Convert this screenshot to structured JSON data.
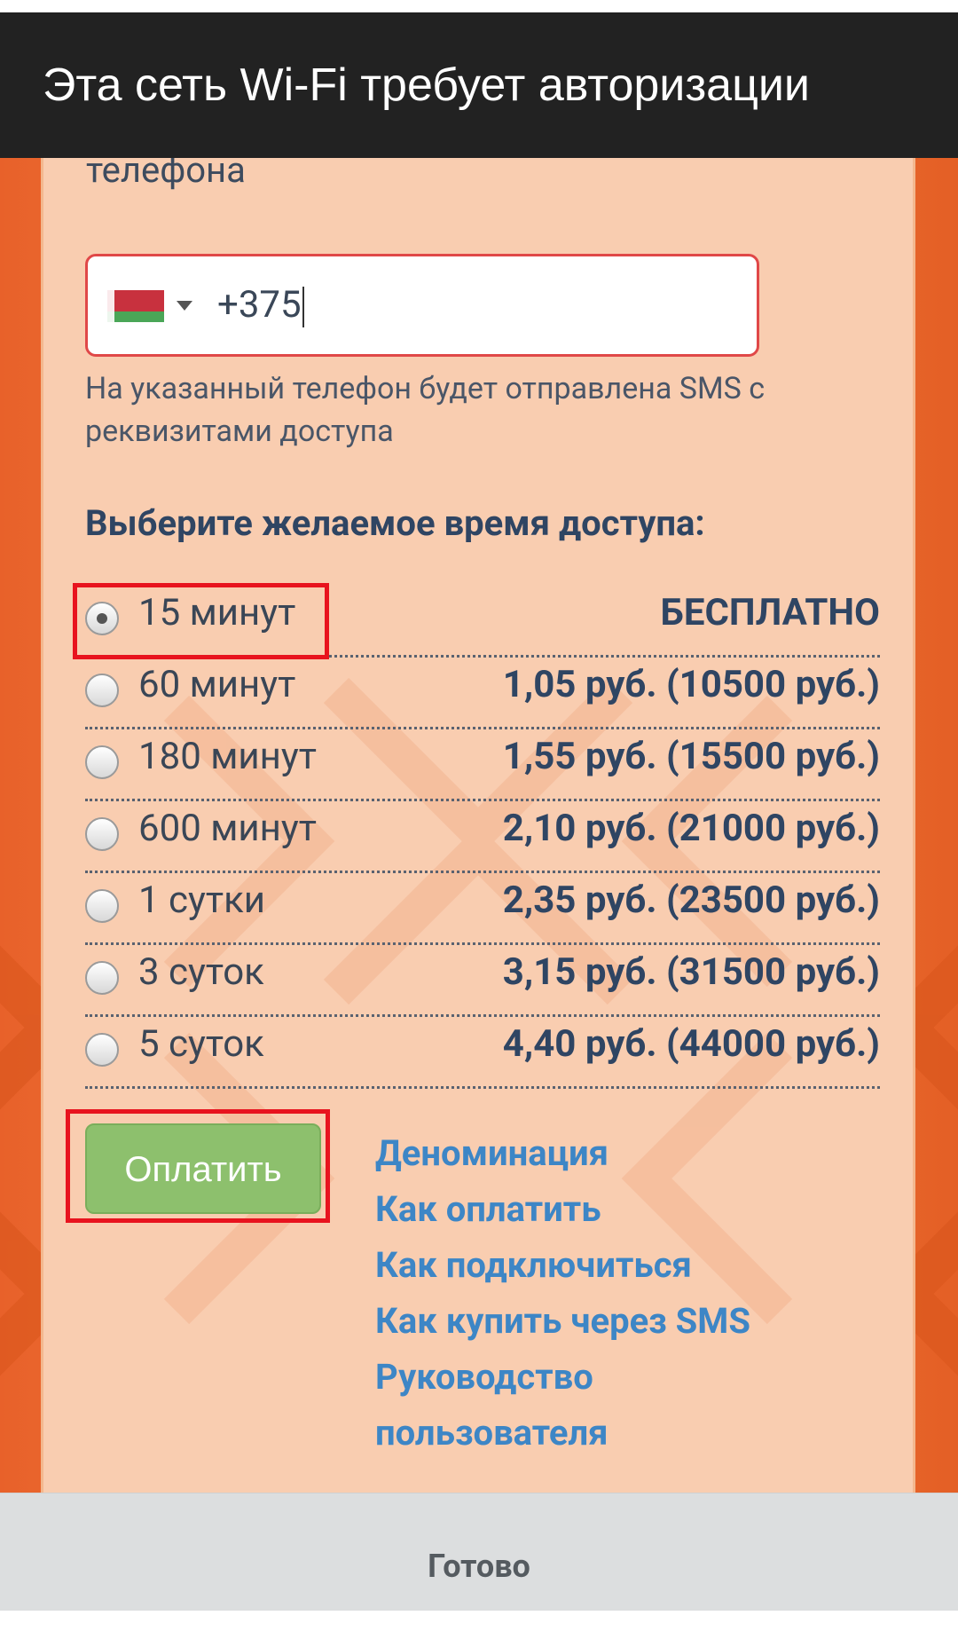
{
  "header": {
    "title": "Эта сеть Wi-Fi требует авторизации"
  },
  "form": {
    "partial_label": "телефона",
    "phone": {
      "country": "Belarus",
      "value": "+375"
    },
    "hint": "На указанный телефон будет отправлена SMS с реквизитами доступа",
    "section_title": "Выберите желаемое время доступа:",
    "options": [
      {
        "label": "15 минут",
        "price": "БЕСПЛАТНО",
        "selected": true
      },
      {
        "label": "60 минут",
        "price": "1,05 руб. (10500 руб.)",
        "selected": false
      },
      {
        "label": "180 минут",
        "price": "1,55 руб. (15500 руб.)",
        "selected": false
      },
      {
        "label": "600 минут",
        "price": "2,10 руб. (21000 руб.)",
        "selected": false
      },
      {
        "label": "1 сутки",
        "price": "2,35 руб. (23500 руб.)",
        "selected": false
      },
      {
        "label": "3 суток",
        "price": "3,15 руб. (31500 руб.)",
        "selected": false
      },
      {
        "label": "5 суток",
        "price": "4,40 руб. (44000 руб.)",
        "selected": false
      }
    ],
    "pay_button": "Оплатить"
  },
  "links": [
    "Деноминация",
    "Как оплатить",
    "Как подключиться",
    "Как купить через SMS",
    "Руководство",
    "пользователя"
  ],
  "footer": {
    "done_label": "Готово"
  },
  "colors": {
    "header_bg": "#222222",
    "accent_orange": "#ee7437",
    "card_bg": "#f9cdb0",
    "link": "#3d86c6",
    "pay_button": "#8dc06d",
    "highlight": "#e8131e"
  }
}
